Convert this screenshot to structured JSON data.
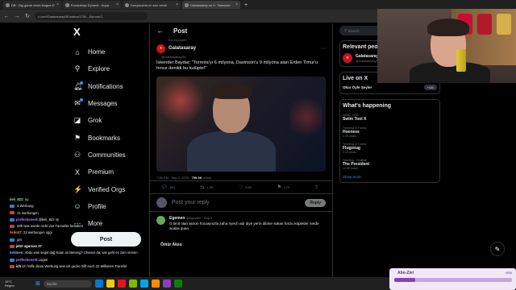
{
  "browser": {
    "tabs": [
      {
        "title": "DB - Big game news league ESE",
        "active": false
      },
      {
        "title": "Eczacıbaşı Dynavit - Kupa",
        "active": false
      },
      {
        "title": "Dunyaca'da en son vendi",
        "active": false
      },
      {
        "title": "Galatasaray on X: \"İskender",
        "active": true
      }
    ],
    "new_tab": "+",
    "url": "x.com/GalatasaraySK/status/1794...0/photo/1"
  },
  "nav": {
    "logo": "X",
    "items": [
      {
        "label": "Home",
        "icon": "home-icon",
        "glyph": "⌂",
        "dot": false
      },
      {
        "label": "Explore",
        "icon": "search-icon",
        "glyph": "⚲",
        "dot": false
      },
      {
        "label": "Notifications",
        "icon": "bell-icon",
        "glyph": "🔔︎",
        "dot": true
      },
      {
        "label": "Messages",
        "icon": "mail-icon",
        "glyph": "✉",
        "dot": true
      },
      {
        "label": "Grok",
        "icon": "grok-icon",
        "glyph": "◪",
        "dot": false
      },
      {
        "label": "Bookmarks",
        "icon": "bookmark-icon",
        "glyph": "⚑",
        "dot": false
      },
      {
        "label": "Communities",
        "icon": "communities-icon",
        "glyph": "⚇",
        "dot": false
      },
      {
        "label": "Premium",
        "icon": "premium-icon",
        "glyph": "X",
        "dot": false
      },
      {
        "label": "Verified Orgs",
        "icon": "verified-orgs-icon",
        "glyph": "⚡",
        "dot": false
      },
      {
        "label": "Profile",
        "icon": "profile-icon",
        "glyph": "☺",
        "dot": false
      },
      {
        "label": "More",
        "icon": "more-icon",
        "glyph": "⋯",
        "dot": false
      }
    ],
    "post_button": "Post"
  },
  "main": {
    "header_title": "Post",
    "reposted_by": "You reposted",
    "author_name": "Galatasaray",
    "author_sub": "@GalatasaraySK",
    "text": "İskender Baydar; \"Torreira'yı 6 milyona, Davinson'u 9 milyona alan Erden Timur'u hırsız denildi bu kulüpte!\"",
    "meta_time": "7:56 PM · Sep 3, 2025 · ",
    "meta_views": "709.3K",
    "meta_views_label": " Views",
    "actions": [
      {
        "icon": "reply-icon",
        "glyph": "💬︎",
        "count": "591"
      },
      {
        "icon": "repost-icon",
        "glyph": "⇆",
        "count": "1.3K"
      },
      {
        "icon": "like-icon",
        "glyph": "♡",
        "count": "5.6K"
      },
      {
        "icon": "bookmark-icon",
        "glyph": "⚑",
        "count": "173"
      },
      {
        "icon": "share-icon",
        "glyph": "⇪",
        "count": ""
      }
    ],
    "reply_placeholder": "Post your reply",
    "reply_button": "Reply",
    "comments": [
      {
        "name": "Egemen",
        "handle": "@egemen · Sep 3",
        "text": "O limit olan sezon hocasınızla zaha riyech adı diye yerin dibine sokan fonzu köpekler nerde acaba quan"
      },
      {
        "name": "Ömür Aksu",
        "handle": "",
        "text": ""
      }
    ]
  },
  "right": {
    "search_placeholder": "Search",
    "relevant_title": "Relevant people",
    "relevant_name": "Galatasaray",
    "relevant_handle": "@GalatasaraySK",
    "live_title": "Live on X",
    "live_name": "Okur Öyle Şeyler",
    "live_count": "+111",
    "happening_title": "What's happening",
    "trends": [
      {
        "cat": "Swim · LIVE",
        "name": "Swim Tool X",
        "cnt": ""
      },
      {
        "cat": "Trending in Turkey",
        "name": "Hoeness",
        "cnt": "4.1K posts"
      },
      {
        "cat": "Trending in Turkey",
        "name": "Flugzeug",
        "cnt": "3.1K posts"
      },
      {
        "cat": "Trending · Football",
        "name": "The President",
        "cnt": "12.4K posts"
      }
    ],
    "show_more": "Show more"
  },
  "chat": [
    {
      "user": "keli_822:",
      "text": "oy",
      "color": "#9be37a",
      "badge": ""
    },
    {
      "user": "",
      "text": "4 Werbung",
      "color": "#ffffff",
      "badge": "#3a7bd5"
    },
    {
      "user": "",
      "text": "21 werbungen",
      "color": "#ffffff",
      "badge": "#d53a3a"
    },
    {
      "user": "prefesboner8",
      "text": "@keli_822 oy",
      "color": "#b77cff",
      "badge": "#3a7bd5"
    },
    {
      "user": "",
      "text": "Mrk was wurde nicht von Tünneller behalten",
      "color": "#ffffff",
      "badge": "#d53a3a"
    },
    {
      "user": "Ardo37:",
      "text": "22 werbungen oggi",
      "color": "#ff9f3a",
      "badge": ""
    },
    {
      "user": "",
      "text": "gm",
      "color": "#ffffff",
      "badge": "#3a7bd5"
    },
    {
      "user": "jetzt ugurcan 27",
      "text": "",
      "color": "#ffffff",
      "badge": "#d53a3a"
    },
    {
      "user": "Kelimen:",
      "text": "Abdu was segst dağ Kaan an Betonig? Chance da, wie geht es zum ninnen Transfer?",
      "color": "#6fc3ff",
      "badge": ""
    },
    {
      "user": "prefesboner8",
      "text": "Lügen",
      "color": "#b77cff",
      "badge": "#3a7bd5"
    },
    {
      "user": "ich",
      "text": "ich hoffe diese Werbung was ich gucke hilft euch 22 Millionen Transfer",
      "color": "#ffffff",
      "badge": "#d53a3a"
    }
  ],
  "alert": {
    "name": "Abo-Ziel",
    "value": "9/50",
    "progress": 0.18
  },
  "taskbar": {
    "weather_temp": "15°C",
    "weather_desc": "Regen",
    "search": "Suche",
    "icon_colors": [
      "#0078d4",
      "#f2c811",
      "#e81123",
      "#7fba00",
      "#00a4ef",
      "#ff8c00",
      "#8a3fb8",
      "#107c10"
    ]
  },
  "colors": {
    "accent": "#1d9bf0",
    "galatasaray_red": "#c8102e",
    "galatasaray_yellow": "#fde100"
  }
}
